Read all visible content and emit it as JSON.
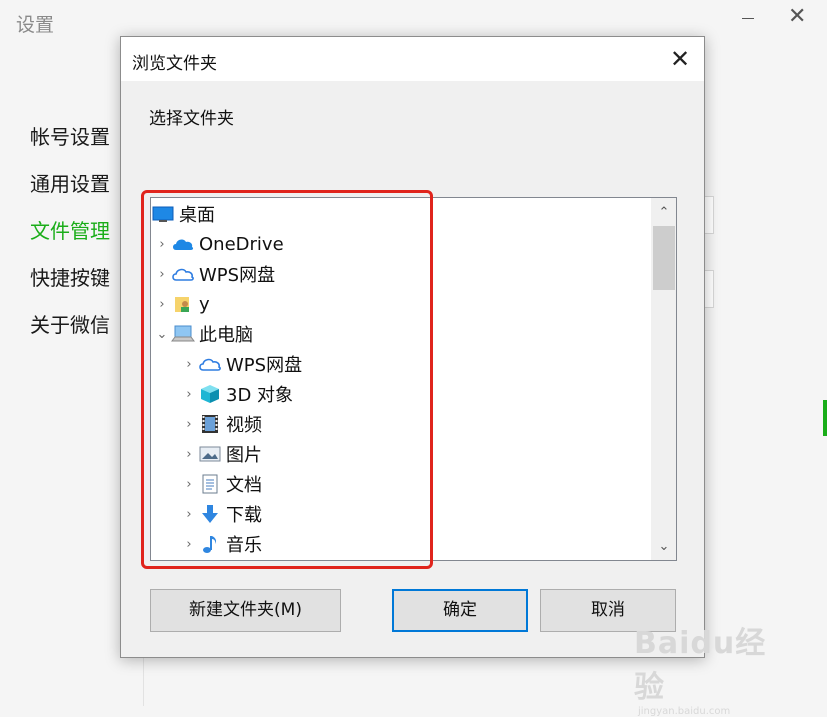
{
  "settings": {
    "title": "设置",
    "close_glyph": "✕",
    "nav": [
      "帐号设置",
      "通用设置",
      "文件管理",
      "快捷按键",
      "关于微信"
    ],
    "active_index": 2
  },
  "dialog": {
    "title": "浏览文件夹",
    "close_glyph": "✕",
    "prompt": "选择文件夹",
    "tree": [
      {
        "label": "桌面",
        "icon": "desktop-icon",
        "chevron": ""
      },
      {
        "label": "OneDrive",
        "icon": "onedrive-cloud-icon",
        "chevron": "›"
      },
      {
        "label": "WPS网盘",
        "icon": "wps-cloud-icon",
        "chevron": "›"
      },
      {
        "label": "y",
        "icon": "user-folder-icon",
        "chevron": "›"
      },
      {
        "label": "此电脑",
        "icon": "this-pc-icon",
        "chevron": "⌄"
      },
      {
        "label": "WPS网盘",
        "icon": "wps-cloud-icon",
        "chevron": "›"
      },
      {
        "label": "3D 对象",
        "icon": "3d-objects-icon",
        "chevron": "›"
      },
      {
        "label": "视频",
        "icon": "video-icon",
        "chevron": "›"
      },
      {
        "label": "图片",
        "icon": "pictures-icon",
        "chevron": "›"
      },
      {
        "label": "文档",
        "icon": "documents-icon",
        "chevron": "›"
      },
      {
        "label": "下载",
        "icon": "download-icon",
        "chevron": "›"
      },
      {
        "label": "音乐",
        "icon": "music-icon",
        "chevron": "›"
      }
    ],
    "scroll_up": "⌃",
    "scroll_down": "⌄",
    "buttons": {
      "new_folder": "新建文件夹(M)",
      "ok": "确定",
      "cancel": "取消"
    }
  },
  "watermark": {
    "main": "Baidu经验",
    "sub": "jingyan.baidu.com"
  },
  "colors": {
    "accent_green": "#1aad19",
    "highlight_red": "#e0241c",
    "focus_blue": "#0078d7"
  }
}
